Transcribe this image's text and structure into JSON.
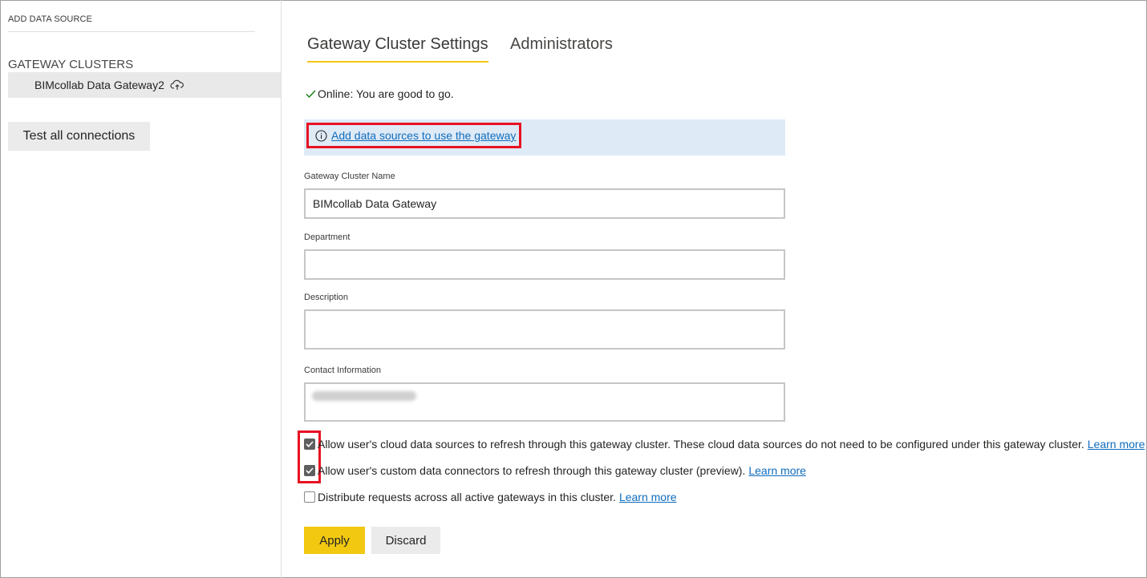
{
  "sidebar": {
    "add_data_source": "ADD DATA SOURCE",
    "clusters_heading": "GATEWAY CLUSTERS",
    "cluster_name": "BIMcollab Data Gateway2",
    "test_all_label": "Test all connections"
  },
  "tabs": [
    {
      "label": "Gateway Cluster Settings",
      "active": true
    },
    {
      "label": "Administrators",
      "active": false
    }
  ],
  "status": {
    "text": "Online: You are good to go."
  },
  "banner": {
    "link_text": "Add data sources to use the gateway"
  },
  "form": {
    "name_label": "Gateway Cluster Name",
    "name_value": "BIMcollab Data Gateway",
    "department_label": "Department",
    "department_value": "",
    "description_label": "Description",
    "description_value": "",
    "contact_label": "Contact Information"
  },
  "options": [
    {
      "text": "Allow user's cloud data sources to refresh through this gateway cluster. These cloud data sources do not need to be configured under this gateway cluster.",
      "link": "Learn more",
      "checked": true
    },
    {
      "text": "Allow user's custom data connectors to refresh through this gateway cluster (preview).",
      "link": "Learn more",
      "checked": true
    },
    {
      "text": "Distribute requests across all active gateways in this cluster.",
      "link": "Learn more",
      "checked": false
    }
  ],
  "buttons": {
    "apply": "Apply",
    "discard": "Discard"
  },
  "colors": {
    "accent_yellow": "#f2c811",
    "link_blue": "#0f6cbd",
    "highlight_red": "#e81123",
    "banner_bg": "#deeaf6",
    "status_green": "#107c10"
  }
}
